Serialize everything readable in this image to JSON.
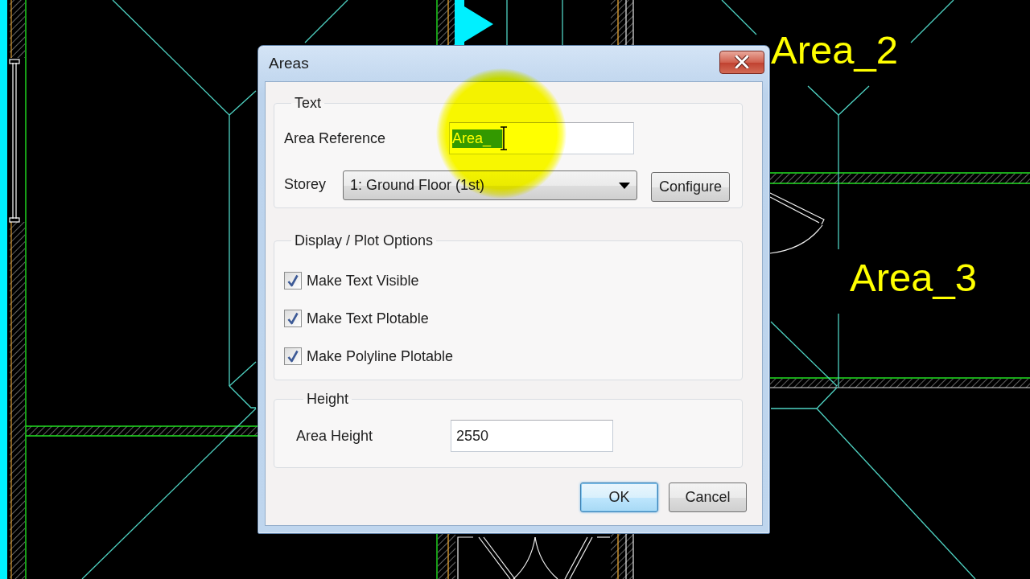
{
  "window": {
    "title": "Areas"
  },
  "text_group": {
    "title": "Text",
    "area_reference": {
      "label": "Area Reference",
      "value": "Area_",
      "selected": true
    },
    "storey": {
      "label": "Storey",
      "value": "1: Ground Floor (1st)"
    },
    "configure_button": "Configure"
  },
  "display_group": {
    "title": "Display / Plot Options",
    "options": [
      {
        "label": "Make Text Visible",
        "checked": true
      },
      {
        "label": "Make Text Plotable",
        "checked": true
      },
      {
        "label": "Make Polyline Plotable",
        "checked": true
      }
    ]
  },
  "height_group": {
    "title": "Height",
    "area_height": {
      "label": "Area Height",
      "value": "2550"
    }
  },
  "buttons": [
    {
      "label": "OK",
      "default": true
    },
    {
      "label": "Cancel",
      "default": false
    }
  ],
  "drawing_labels": [
    {
      "text": "Area_2"
    },
    {
      "text": "Area_3"
    }
  ]
}
